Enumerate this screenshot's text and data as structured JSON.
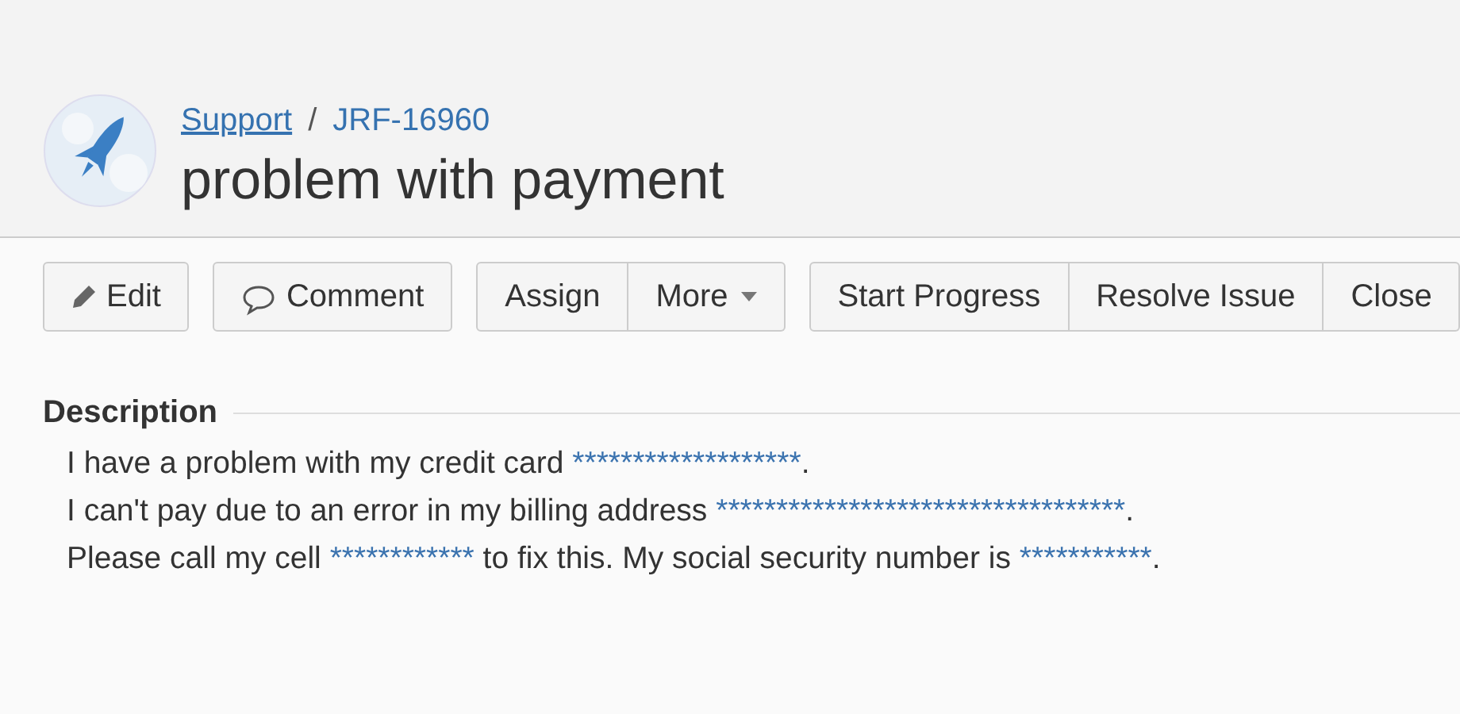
{
  "breadcrumb": {
    "project": "Support",
    "separator": "/",
    "issue_key": "JRF-16960"
  },
  "title": "problem with payment",
  "toolbar": [
    [
      {
        "label": "Edit"
      }
    ],
    [
      {
        "label": "Comment"
      }
    ],
    [
      {
        "label": "Assign"
      },
      {
        "label": "More"
      }
    ],
    [
      {
        "label": "Start Progress"
      },
      {
        "label": "Resolve Issue"
      },
      {
        "label": "Close"
      }
    ]
  ],
  "description": {
    "heading": "Description",
    "lines": [
      [
        {
          "text": "I have a problem with my credit card ",
          "masked": false
        },
        {
          "text": "*******************",
          "masked": true
        },
        {
          "text": ".",
          "masked": false
        }
      ],
      [
        {
          "text": "I can't pay due to an error in my billing address ",
          "masked": false
        },
        {
          "text": "**********************************",
          "masked": true
        },
        {
          "text": ".",
          "masked": false
        }
      ],
      [
        {
          "text": "Please call my cell ",
          "masked": false
        },
        {
          "text": "************",
          "masked": true
        },
        {
          "text": " to fix this. My social security number is ",
          "masked": false
        },
        {
          "text": "***********",
          "masked": true
        },
        {
          "text": ".",
          "masked": false
        }
      ]
    ]
  }
}
